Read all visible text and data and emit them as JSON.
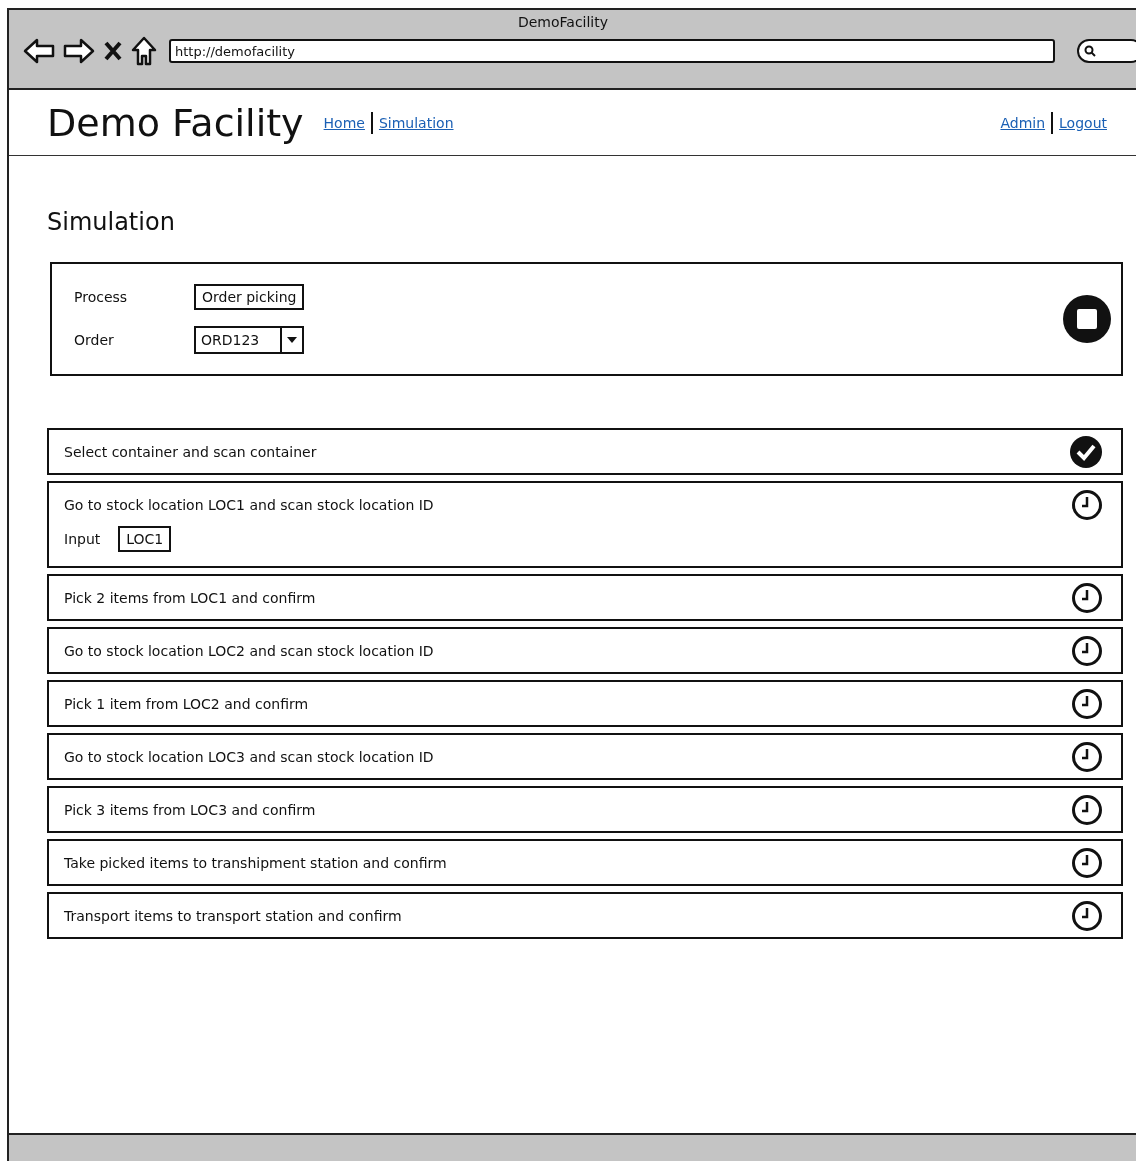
{
  "browser": {
    "title": "DemoFacility",
    "url": "http://demofacility"
  },
  "header": {
    "brand": "Demo Facility",
    "nav": [
      {
        "label": "Home"
      },
      {
        "label": "Simulation"
      }
    ],
    "user_nav": [
      {
        "label": "Admin"
      },
      {
        "label": "Logout"
      }
    ]
  },
  "page_title": "Simulation",
  "form": {
    "fields": [
      {
        "kind": "text",
        "label": "Process",
        "value": "Order picking"
      },
      {
        "kind": "select",
        "label": "Order",
        "value": "ORD123"
      }
    ]
  },
  "steps": [
    {
      "text": "Select container and scan container",
      "done": true
    },
    {
      "text": "Go to stock location LOC1 and scan stock location ID",
      "done": false,
      "input": {
        "label": "Input",
        "value": "LOC1"
      }
    },
    {
      "text": "Pick 2 items from LOC1 and confirm",
      "done": false
    },
    {
      "text": "Go to stock location LOC2 and scan stock location ID",
      "done": false
    },
    {
      "text": "Pick 1 item from LOC2 and confirm",
      "done": false
    },
    {
      "text": "Go to stock location LOC3 and scan stock location ID",
      "done": false
    },
    {
      "text": "Pick 3 items from LOC3 and confirm",
      "done": false
    },
    {
      "text": "Take picked items to transhipment station and confirm",
      "done": false
    },
    {
      "text": "Transport items to transport station and confirm",
      "done": false
    }
  ]
}
